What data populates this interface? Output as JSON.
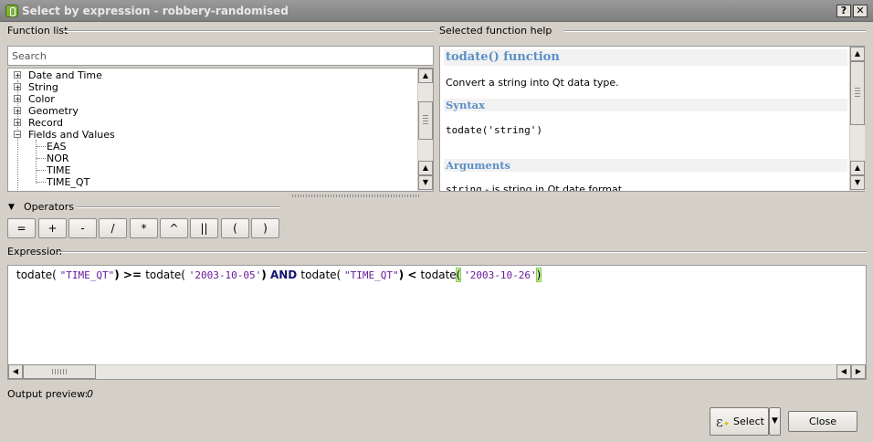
{
  "window": {
    "title": "Select by expression - robbery-randomised",
    "help_btn": "?",
    "close_btn": "✕"
  },
  "function_list": {
    "label": "Function list",
    "search_placeholder": "Search",
    "groups": [
      {
        "label": "Date and Time",
        "expanded": false
      },
      {
        "label": "String",
        "expanded": false
      },
      {
        "label": "Color",
        "expanded": false
      },
      {
        "label": "Geometry",
        "expanded": false
      },
      {
        "label": "Record",
        "expanded": false
      },
      {
        "label": "Fields and Values",
        "expanded": true
      }
    ],
    "fields": [
      "EAS",
      "NOR",
      "TIME",
      "TIME_QT"
    ]
  },
  "help": {
    "label": "Selected function help",
    "title": "todate() function",
    "description": "Convert a string into Qt data type.",
    "syntax_heading": "Syntax",
    "syntax": "todate('string')",
    "arguments_heading": "Arguments",
    "argument_name": "string",
    "argument_desc": " - is string in Qt date format"
  },
  "operators": {
    "label": "Operators",
    "buttons": [
      "=",
      "+",
      "-",
      "/",
      "*",
      "^",
      "||",
      "(",
      ")"
    ]
  },
  "expression": {
    "label": "Expression",
    "tokens": [
      {
        "t": "todate( ",
        "c": "fn"
      },
      {
        "t": "\"TIME_QT\"",
        "c": "str"
      },
      {
        "t": ") ",
        "c": "br"
      },
      {
        "t": ">= ",
        "c": "br"
      },
      {
        "t": "todate( ",
        "c": "fn"
      },
      {
        "t": "'2003-10-05'",
        "c": "str"
      },
      {
        "t": ") ",
        "c": "br"
      },
      {
        "t": "AND ",
        "c": "kw"
      },
      {
        "t": "todate( ",
        "c": "fn"
      },
      {
        "t": "\"TIME_QT\"",
        "c": "str"
      },
      {
        "t": ") ",
        "c": "br"
      },
      {
        "t": "< ",
        "c": "br"
      },
      {
        "t": "todate",
        "c": "fn"
      },
      {
        "t": "(",
        "c": "hl"
      },
      {
        "t": " ",
        "c": "fn"
      },
      {
        "t": "'2003-10-26'",
        "c": "str"
      },
      {
        "t": ")",
        "c": "hl"
      }
    ]
  },
  "output_preview": {
    "label": "Output preview:",
    "value": "0"
  },
  "buttons": {
    "select": "Select",
    "close": "Close"
  },
  "icons": {
    "app": "qgis-icon",
    "select": "expression-icon",
    "dropdown": "dropdown-arrow-icon"
  }
}
